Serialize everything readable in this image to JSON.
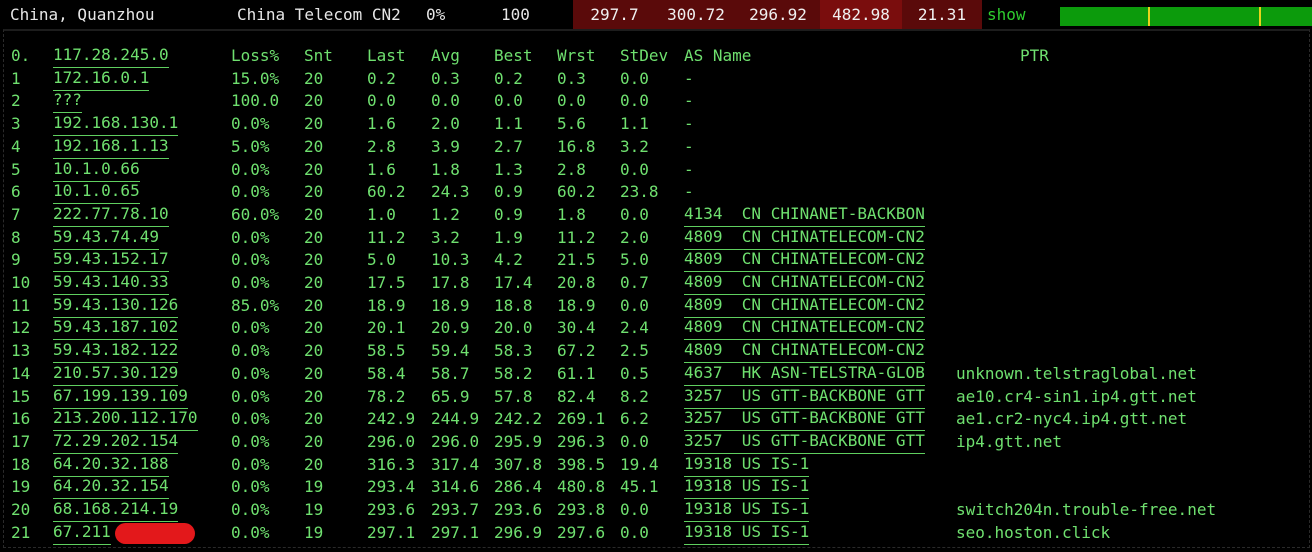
{
  "topbar": {
    "location": "China, Quanzhou",
    "carrier": "China Telecom CN2",
    "loss": "0%",
    "sent": "100",
    "stats": [
      "297.7",
      "300.72",
      "296.92",
      "482.98",
      "21.31"
    ],
    "show_label": "show",
    "colors": {
      "stat_dark": "#5a0a0a",
      "stat_mid": "#7a0d0d",
      "graph": "#0c9b0c",
      "graph_mark": "#e7d31b"
    },
    "graph_marks": [
      0.35,
      0.79
    ]
  },
  "table": {
    "headers": {
      "num": "0.",
      "host": "117.28.245.0",
      "loss": "Loss%",
      "snt": "Snt",
      "last": "Last",
      "avg": "Avg",
      "best": "Best",
      "wrst": "Wrst",
      "stdev": "StDev",
      "asname": "AS Name",
      "ptr": "PTR"
    },
    "rows": [
      {
        "n": "1",
        "host": "172.16.0.1",
        "loss": "15.0%",
        "snt": "20",
        "last": "0.2",
        "avg": "0.3",
        "best": "0.2",
        "wrst": "0.3",
        "stdev": "0.0",
        "as": "-",
        "ptr": ""
      },
      {
        "n": "2",
        "host": "???",
        "loss": "100.0",
        "snt": "20",
        "last": "0.0",
        "avg": "0.0",
        "best": "0.0",
        "wrst": "0.0",
        "stdev": "0.0",
        "as": "-",
        "ptr": ""
      },
      {
        "n": "3",
        "host": "192.168.130.1",
        "loss": "0.0%",
        "snt": "20",
        "last": "1.6",
        "avg": "2.0",
        "best": "1.1",
        "wrst": "5.6",
        "stdev": "1.1",
        "as": "-",
        "ptr": ""
      },
      {
        "n": "4",
        "host": "192.168.1.13",
        "loss": "5.0%",
        "snt": "20",
        "last": "2.8",
        "avg": "3.9",
        "best": "2.7",
        "wrst": "16.8",
        "stdev": "3.2",
        "as": "-",
        "ptr": ""
      },
      {
        "n": "5",
        "host": "10.1.0.66",
        "loss": "0.0%",
        "snt": "20",
        "last": "1.6",
        "avg": "1.8",
        "best": "1.3",
        "wrst": "2.8",
        "stdev": "0.0",
        "as": "-",
        "ptr": ""
      },
      {
        "n": "6",
        "host": "10.1.0.65",
        "loss": "0.0%",
        "snt": "20",
        "last": "60.2",
        "avg": "24.3",
        "best": "0.9",
        "wrst": "60.2",
        "stdev": "23.8",
        "as": "-",
        "ptr": ""
      },
      {
        "n": "7",
        "host": "222.77.78.10",
        "loss": "60.0%",
        "snt": "20",
        "last": "1.0",
        "avg": "1.2",
        "best": "0.9",
        "wrst": "1.8",
        "stdev": "0.0",
        "as": "4134  CN CHINANET-BACKBON",
        "ptr": ""
      },
      {
        "n": "8",
        "host": "59.43.74.49",
        "loss": "0.0%",
        "snt": "20",
        "last": "11.2",
        "avg": "3.2",
        "best": "1.9",
        "wrst": "11.2",
        "stdev": "2.0",
        "as": "4809  CN CHINATELECOM-CN2",
        "ptr": ""
      },
      {
        "n": "9",
        "host": "59.43.152.17",
        "loss": "0.0%",
        "snt": "20",
        "last": "5.0",
        "avg": "10.3",
        "best": "4.2",
        "wrst": "21.5",
        "stdev": "5.0",
        "as": "4809  CN CHINATELECOM-CN2",
        "ptr": ""
      },
      {
        "n": "10",
        "host": "59.43.140.33",
        "loss": "0.0%",
        "snt": "20",
        "last": "17.5",
        "avg": "17.8",
        "best": "17.4",
        "wrst": "20.8",
        "stdev": "0.7",
        "as": "4809  CN CHINATELECOM-CN2",
        "ptr": ""
      },
      {
        "n": "11",
        "host": "59.43.130.126",
        "loss": "85.0%",
        "snt": "20",
        "last": "18.9",
        "avg": "18.9",
        "best": "18.8",
        "wrst": "18.9",
        "stdev": "0.0",
        "as": "4809  CN CHINATELECOM-CN2",
        "ptr": ""
      },
      {
        "n": "12",
        "host": "59.43.187.102",
        "loss": "0.0%",
        "snt": "20",
        "last": "20.1",
        "avg": "20.9",
        "best": "20.0",
        "wrst": "30.4",
        "stdev": "2.4",
        "as": "4809  CN CHINATELECOM-CN2",
        "ptr": ""
      },
      {
        "n": "13",
        "host": "59.43.182.122",
        "loss": "0.0%",
        "snt": "20",
        "last": "58.5",
        "avg": "59.4",
        "best": "58.3",
        "wrst": "67.2",
        "stdev": "2.5",
        "as": "4809  CN CHINATELECOM-CN2",
        "ptr": ""
      },
      {
        "n": "14",
        "host": "210.57.30.129",
        "loss": "0.0%",
        "snt": "20",
        "last": "58.4",
        "avg": "58.7",
        "best": "58.2",
        "wrst": "61.1",
        "stdev": "0.5",
        "as": "4637  HK ASN-TELSTRA-GLOB",
        "ptr": "unknown.telstraglobal.net"
      },
      {
        "n": "15",
        "host": "67.199.139.109",
        "loss": "0.0%",
        "snt": "20",
        "last": "78.2",
        "avg": "65.9",
        "best": "57.8",
        "wrst": "82.4",
        "stdev": "8.2",
        "as": "3257  US GTT-BACKBONE GTT",
        "ptr": "ae10.cr4-sin1.ip4.gtt.net"
      },
      {
        "n": "16",
        "host": "213.200.112.170",
        "loss": "0.0%",
        "snt": "20",
        "last": "242.9",
        "avg": "244.9",
        "best": "242.2",
        "wrst": "269.1",
        "stdev": "6.2",
        "as": "3257  US GTT-BACKBONE GTT",
        "ptr": "ae1.cr2-nyc4.ip4.gtt.net"
      },
      {
        "n": "17",
        "host": "72.29.202.154",
        "loss": "0.0%",
        "snt": "20",
        "last": "296.0",
        "avg": "296.0",
        "best": "295.9",
        "wrst": "296.3",
        "stdev": "0.0",
        "as": "3257  US GTT-BACKBONE GTT",
        "ptr": "ip4.gtt.net"
      },
      {
        "n": "18",
        "host": "64.20.32.188",
        "loss": "0.0%",
        "snt": "20",
        "last": "316.3",
        "avg": "317.4",
        "best": "307.8",
        "wrst": "398.5",
        "stdev": "19.4",
        "as": "19318 US IS-1",
        "ptr": ""
      },
      {
        "n": "19",
        "host": "64.20.32.154",
        "loss": "0.0%",
        "snt": "19",
        "last": "293.4",
        "avg": "314.6",
        "best": "286.4",
        "wrst": "480.8",
        "stdev": "45.1",
        "as": "19318 US IS-1",
        "ptr": ""
      },
      {
        "n": "20",
        "host": "68.168.214.19",
        "loss": "0.0%",
        "snt": "19",
        "last": "293.6",
        "avg": "293.7",
        "best": "293.6",
        "wrst": "293.8",
        "stdev": "0.0",
        "as": "19318 US IS-1",
        "ptr": "switch204n.trouble-free.net"
      },
      {
        "n": "21",
        "host": "67.211",
        "loss": "0.0%",
        "snt": "19",
        "last": "297.1",
        "avg": "297.1",
        "best": "296.9",
        "wrst": "297.6",
        "stdev": "0.0",
        "as": "19318 US IS-1",
        "ptr": "seo.hoston.click"
      }
    ]
  }
}
